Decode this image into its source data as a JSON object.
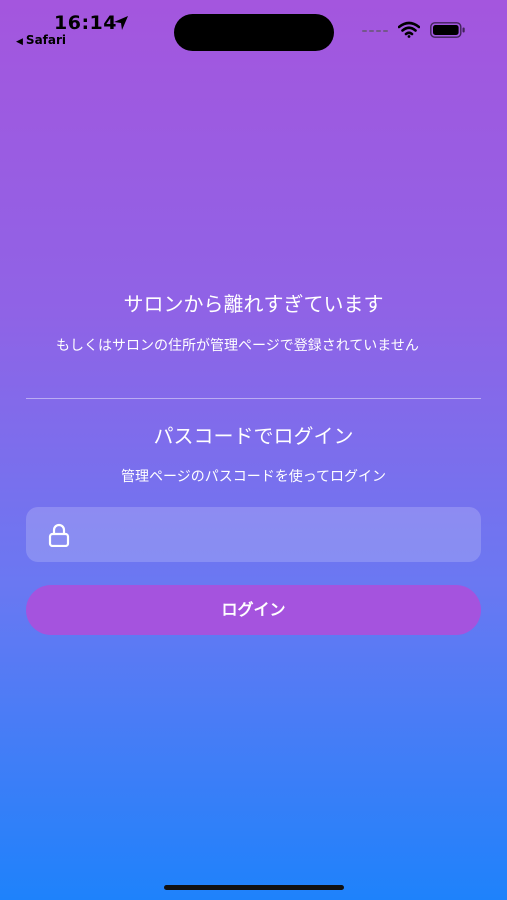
{
  "status_bar": {
    "time": "16:14",
    "back_app": "Safari"
  },
  "notice": {
    "title": "サロンから離れすぎています",
    "message": "もしくはサロンの住所が管理ページで登録されていません"
  },
  "passcode_login": {
    "title": "パスコードでログイン",
    "hint": "管理ページのパスコードを使ってログイン",
    "input_value": "",
    "login_label": "ログイン"
  },
  "icons": [
    "location-arrow-icon",
    "signal-icon",
    "wifi-icon",
    "battery-icon",
    "lock-icon"
  ]
}
